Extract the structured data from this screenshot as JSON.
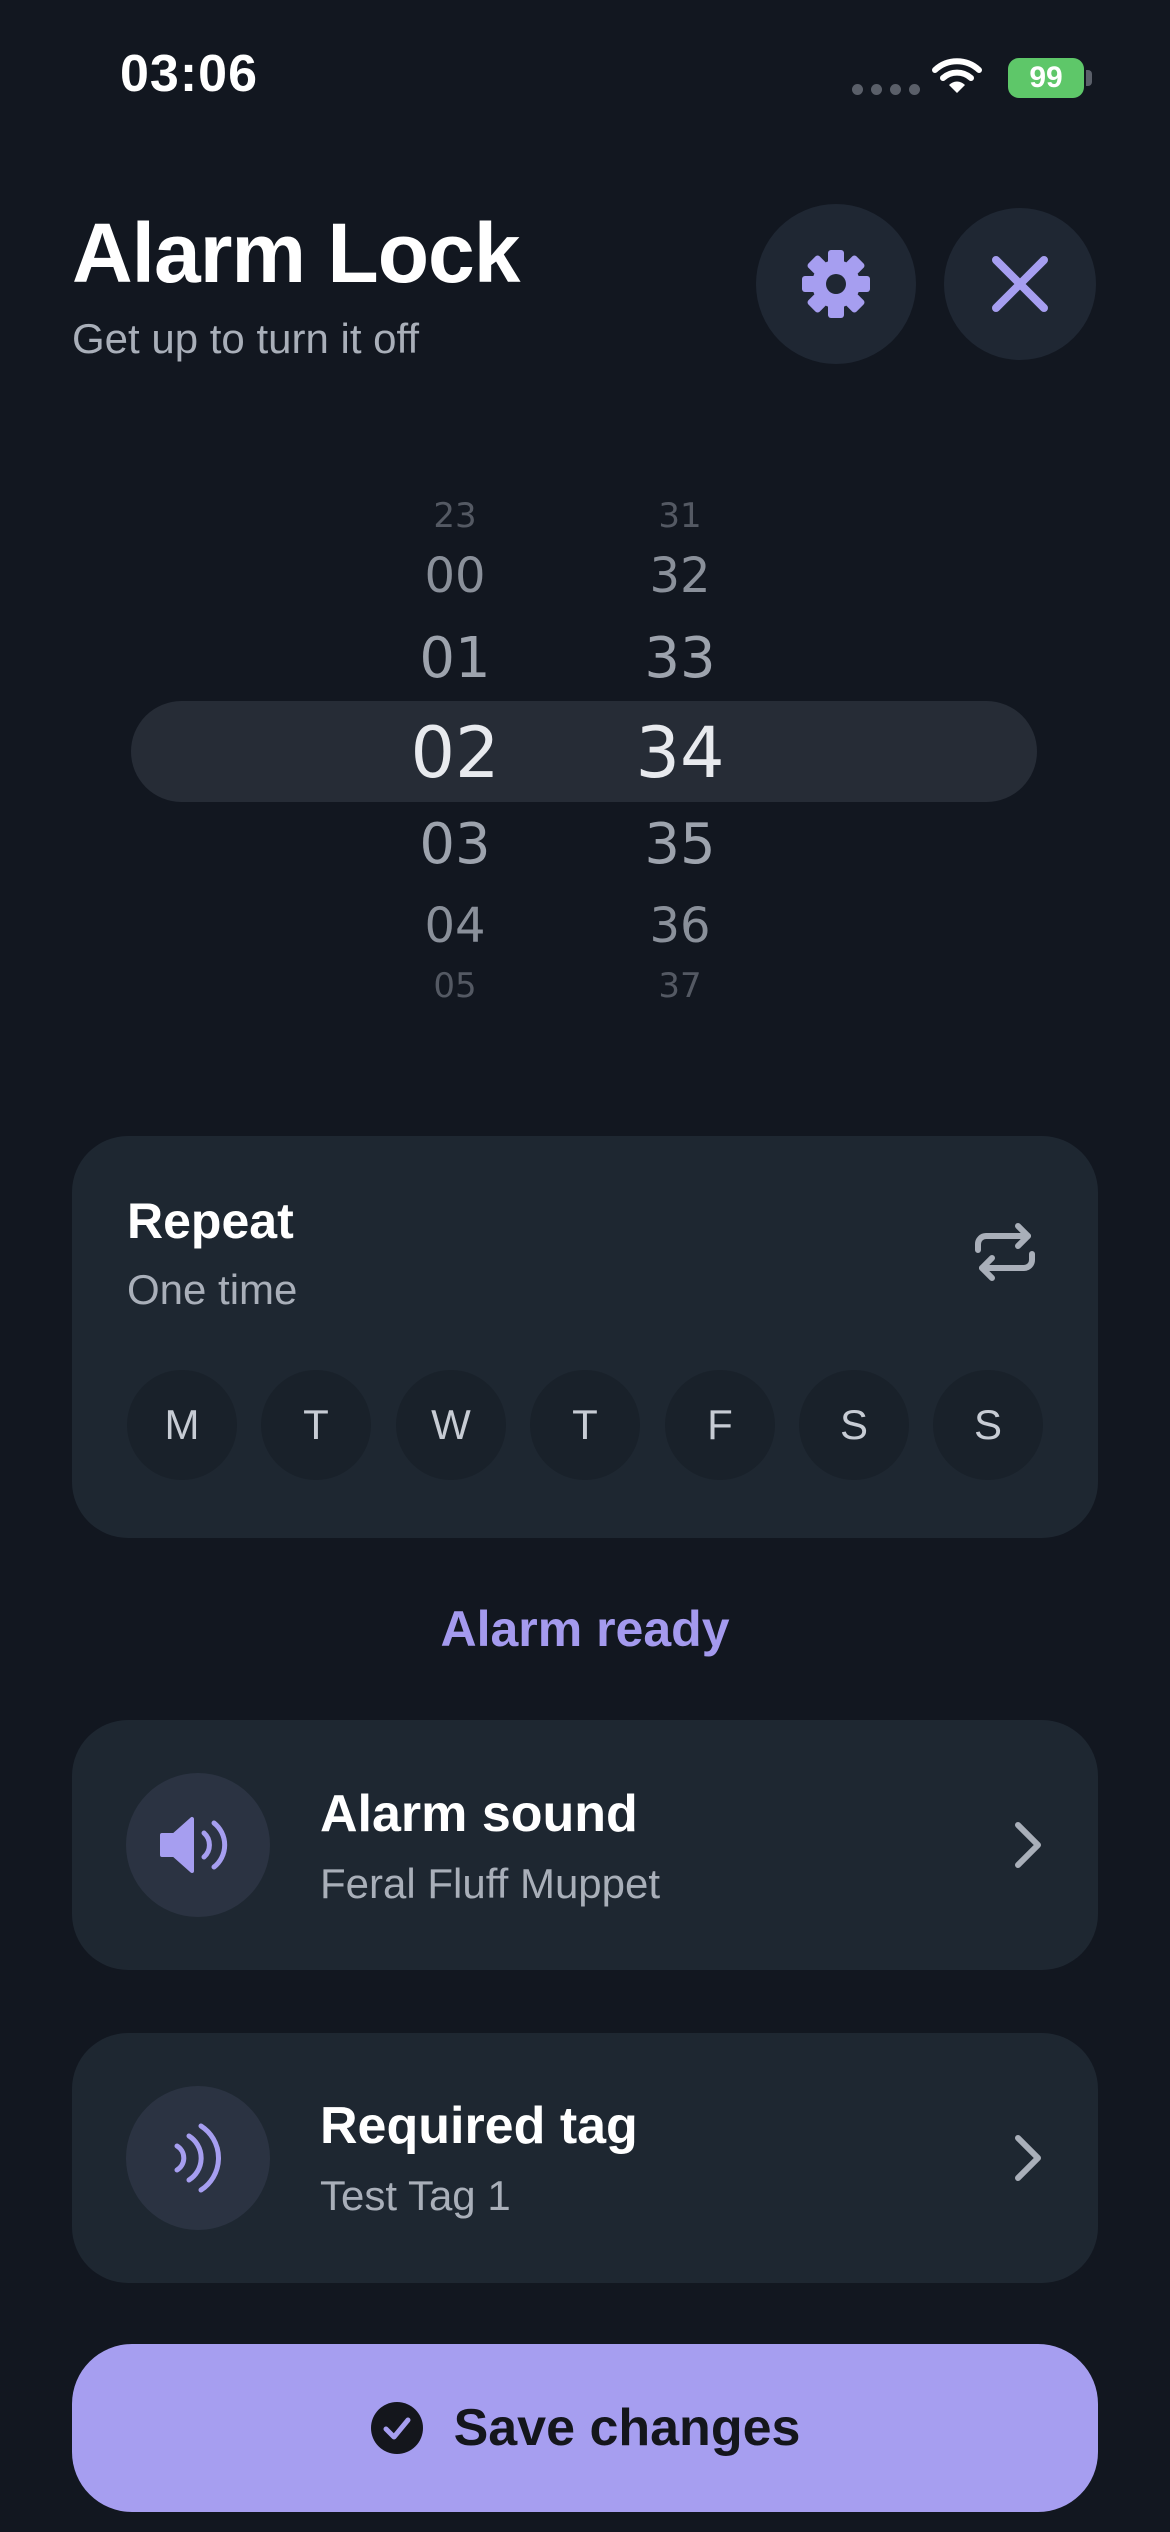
{
  "status_bar": {
    "time": "03:06",
    "battery": "99"
  },
  "header": {
    "title": "Alarm Lock",
    "subtitle": "Get up to turn it off"
  },
  "picker": {
    "hours": [
      "23",
      "00",
      "01",
      "02",
      "03",
      "04",
      "05"
    ],
    "minutes": [
      "31",
      "32",
      "33",
      "34",
      "35",
      "36",
      "37"
    ],
    "selected_hour": "02",
    "selected_minute": "34"
  },
  "repeat": {
    "title": "Repeat",
    "value": "One time",
    "days": [
      "M",
      "T",
      "W",
      "T",
      "F",
      "S",
      "S"
    ]
  },
  "status_message": "Alarm ready",
  "alarm_sound": {
    "title": "Alarm sound",
    "value": "Feral Fluff Muppet"
  },
  "required_tag": {
    "title": "Required tag",
    "value": "Test Tag 1"
  },
  "save_button": {
    "label": "Save changes"
  },
  "colors": {
    "background": "#121720",
    "card": "#1e2731",
    "accent": "#a69ef0",
    "battery": "#5ec769"
  }
}
